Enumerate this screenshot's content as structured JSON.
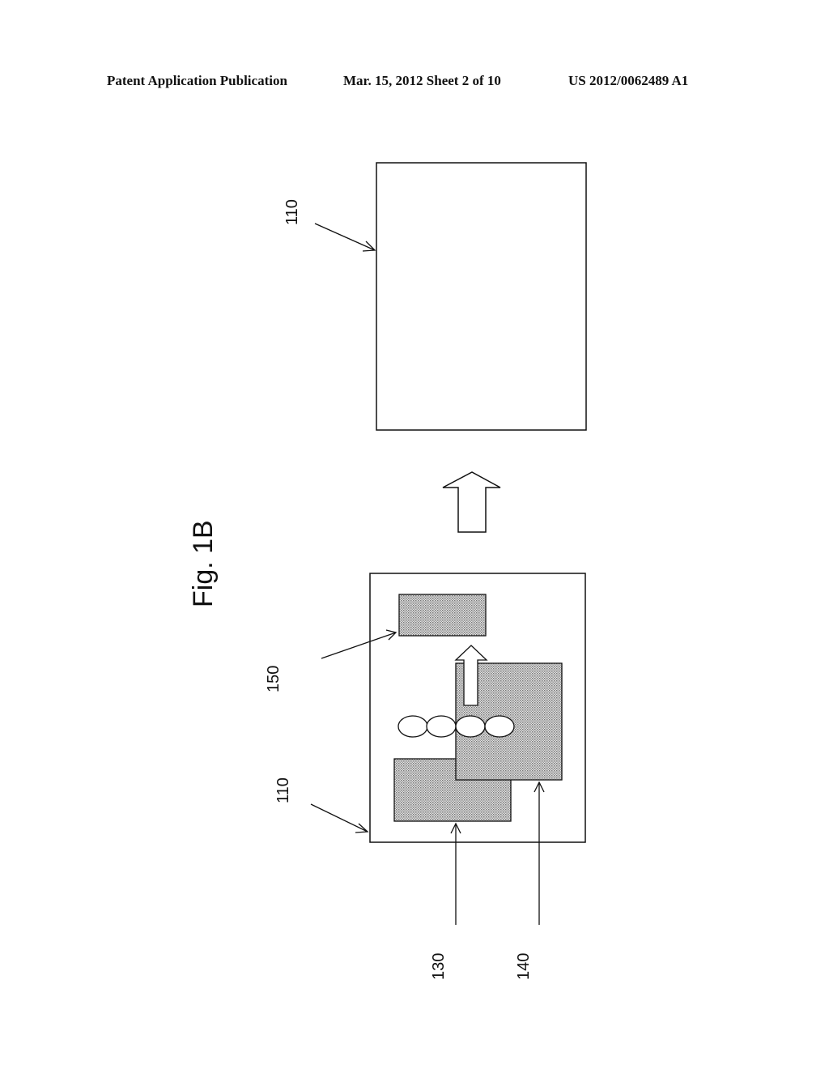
{
  "header": {
    "publication": "Patent Application Publication",
    "date_sheet": "Mar. 15, 2012  Sheet 2 of 10",
    "patent_number": "US 2012/0062489 A1"
  },
  "figure": {
    "title": "Fig. 1B",
    "labels": {
      "top_panel": "110",
      "bottom_panel": "110",
      "region_150": "150",
      "region_130": "130",
      "region_140": "140"
    },
    "colors": {
      "stroke": "#111111",
      "stipple_fill": "#c8c8c8",
      "background": "#ffffff"
    }
  }
}
